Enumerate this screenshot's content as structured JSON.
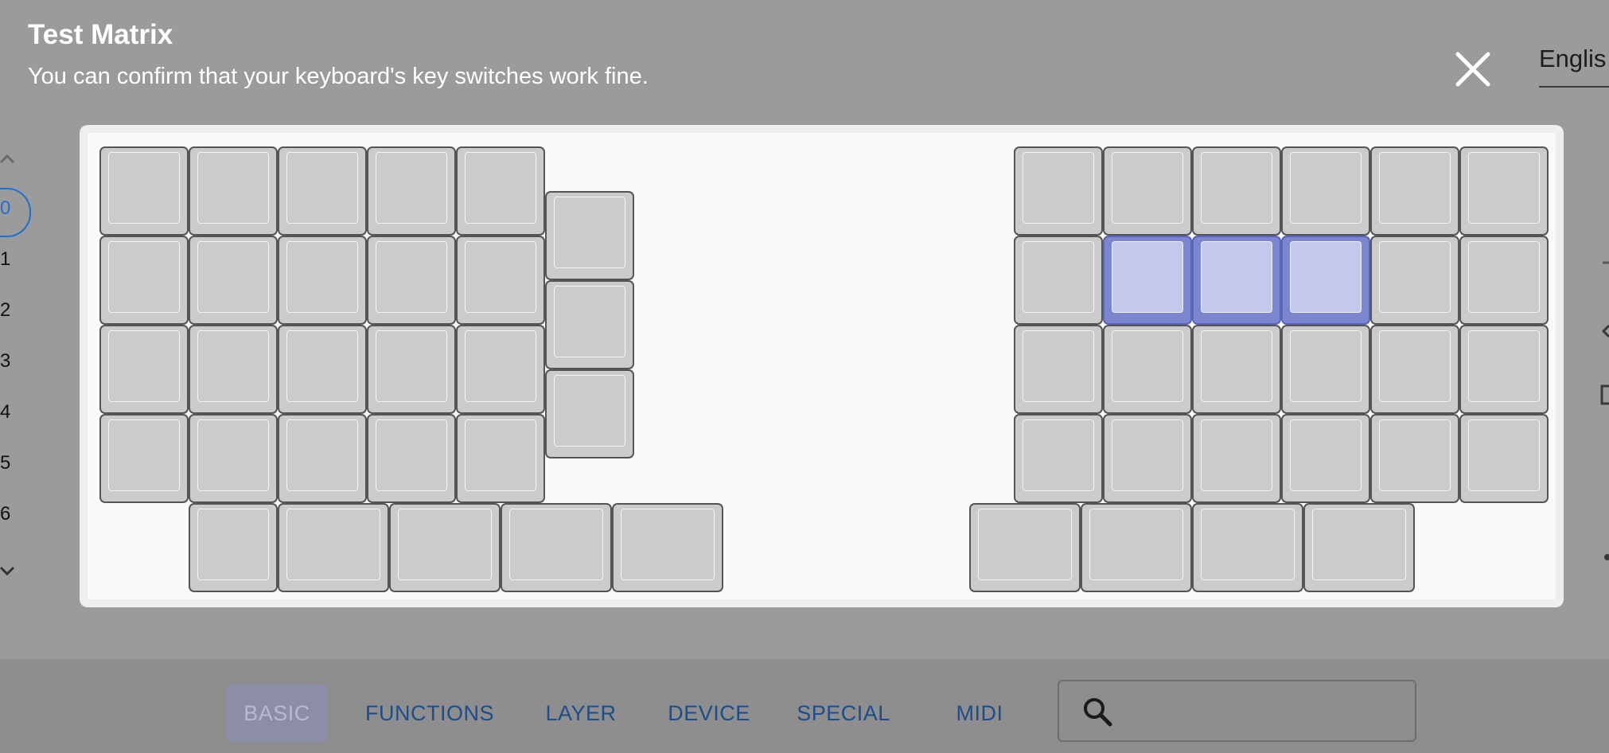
{
  "dialog": {
    "title": "Test Matrix",
    "subtitle": "You can confirm that your keyboard's key switches work fine."
  },
  "language": {
    "value": "Englis"
  },
  "layers": {
    "items": [
      "0",
      "1",
      "2",
      "3",
      "4",
      "5",
      "6"
    ],
    "selected": "0"
  },
  "keyboard": {
    "pressed_color": "#7b86ce",
    "key_color": "#cbcbcb"
  },
  "tabs": [
    {
      "label": "BASIC",
      "active": true
    },
    {
      "label": "FUNCTIONS"
    },
    {
      "label": "LAYER"
    },
    {
      "label": "DEVICE"
    },
    {
      "label": "SPECIAL"
    },
    {
      "label": "MIDI"
    }
  ],
  "search": {
    "placeholder": ""
  },
  "icons": {
    "close": "close-icon",
    "search": "search-icon",
    "layer_up": "chevron-up-icon",
    "layer_down": "chevron-down-icon"
  },
  "colors": {
    "accent": "#1e6fd4",
    "tab_text": "#1c4d8c",
    "overlay": "#9b9b9b"
  }
}
